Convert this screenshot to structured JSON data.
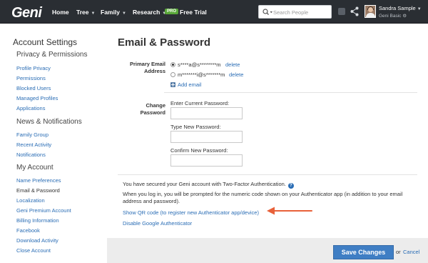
{
  "header": {
    "logo": "Geni",
    "nav": [
      {
        "label": "Home",
        "has_menu": false
      },
      {
        "label": "Tree",
        "has_menu": true
      },
      {
        "label": "Family",
        "has_menu": true
      },
      {
        "label": "Research",
        "has_menu": true
      }
    ],
    "pro_badge": "PRO",
    "free_trial": "Free Trial",
    "search": {
      "placeholder": "Search People",
      "value": ""
    },
    "notification_count": "0",
    "user": {
      "name": "Sandra Sample",
      "plan": "Geni Basic"
    },
    "icons": [
      "search-icon",
      "notification-icon",
      "share-icon",
      "avatar",
      "settings-icon"
    ]
  },
  "sidebar": {
    "title": "Account Settings",
    "sections": [
      {
        "title": "Privacy & Permissions",
        "items": [
          "Profile Privacy",
          "Permissions",
          "Blocked Users",
          "Managed Profiles",
          "Applications"
        ]
      },
      {
        "title": "News & Notifications",
        "items": [
          "Family Group",
          "Recent Activity",
          "Notifications"
        ]
      },
      {
        "title": "My Account",
        "items": [
          "Name Preferences",
          "Email & Password",
          "Localization",
          "Geni Premium Account",
          "Billing Information",
          "Facebook",
          "Download Activity",
          "Close Account"
        ]
      }
    ],
    "active_item": "Email & Password"
  },
  "main": {
    "title": "Email & Password",
    "primary_email": {
      "label_line1": "Primary Email",
      "label_line2": "Address",
      "emails": [
        {
          "address": "s****a@s********m",
          "selected": true,
          "delete_label": "delete"
        },
        {
          "address": "m*******i@s*******m",
          "selected": false,
          "delete_label": "delete"
        }
      ],
      "add_label": "Add email"
    },
    "change_password": {
      "label_line1": "Change",
      "label_line2": "Password",
      "current_label": "Enter Current Password:",
      "new_label": "Type New Password:",
      "confirm_label": "Confirm New Password:"
    },
    "two_factor": {
      "secured_text": "You have secured your Geni account with Two-Factor Authentication.",
      "help_icon": "?",
      "info_text": "When you log in, you will be prompted for the numeric code shown on your Authenticator app (in addition to your email address and password).",
      "qr_link": "Show QR code (to register new Authenticator app/device)",
      "disable_link": "Disable Google Authenticator"
    },
    "footer": {
      "save_label": "Save Changes",
      "or_text": "or",
      "cancel_label": "Cancel"
    },
    "annotation_arrow_color": "#e8613a"
  },
  "colors": {
    "topbar": "#2a2e33",
    "link": "#2a6db5",
    "save_button": "#3f7ec4",
    "logo_accent": "#7bc043",
    "pro_badge": "#5aa83a"
  }
}
